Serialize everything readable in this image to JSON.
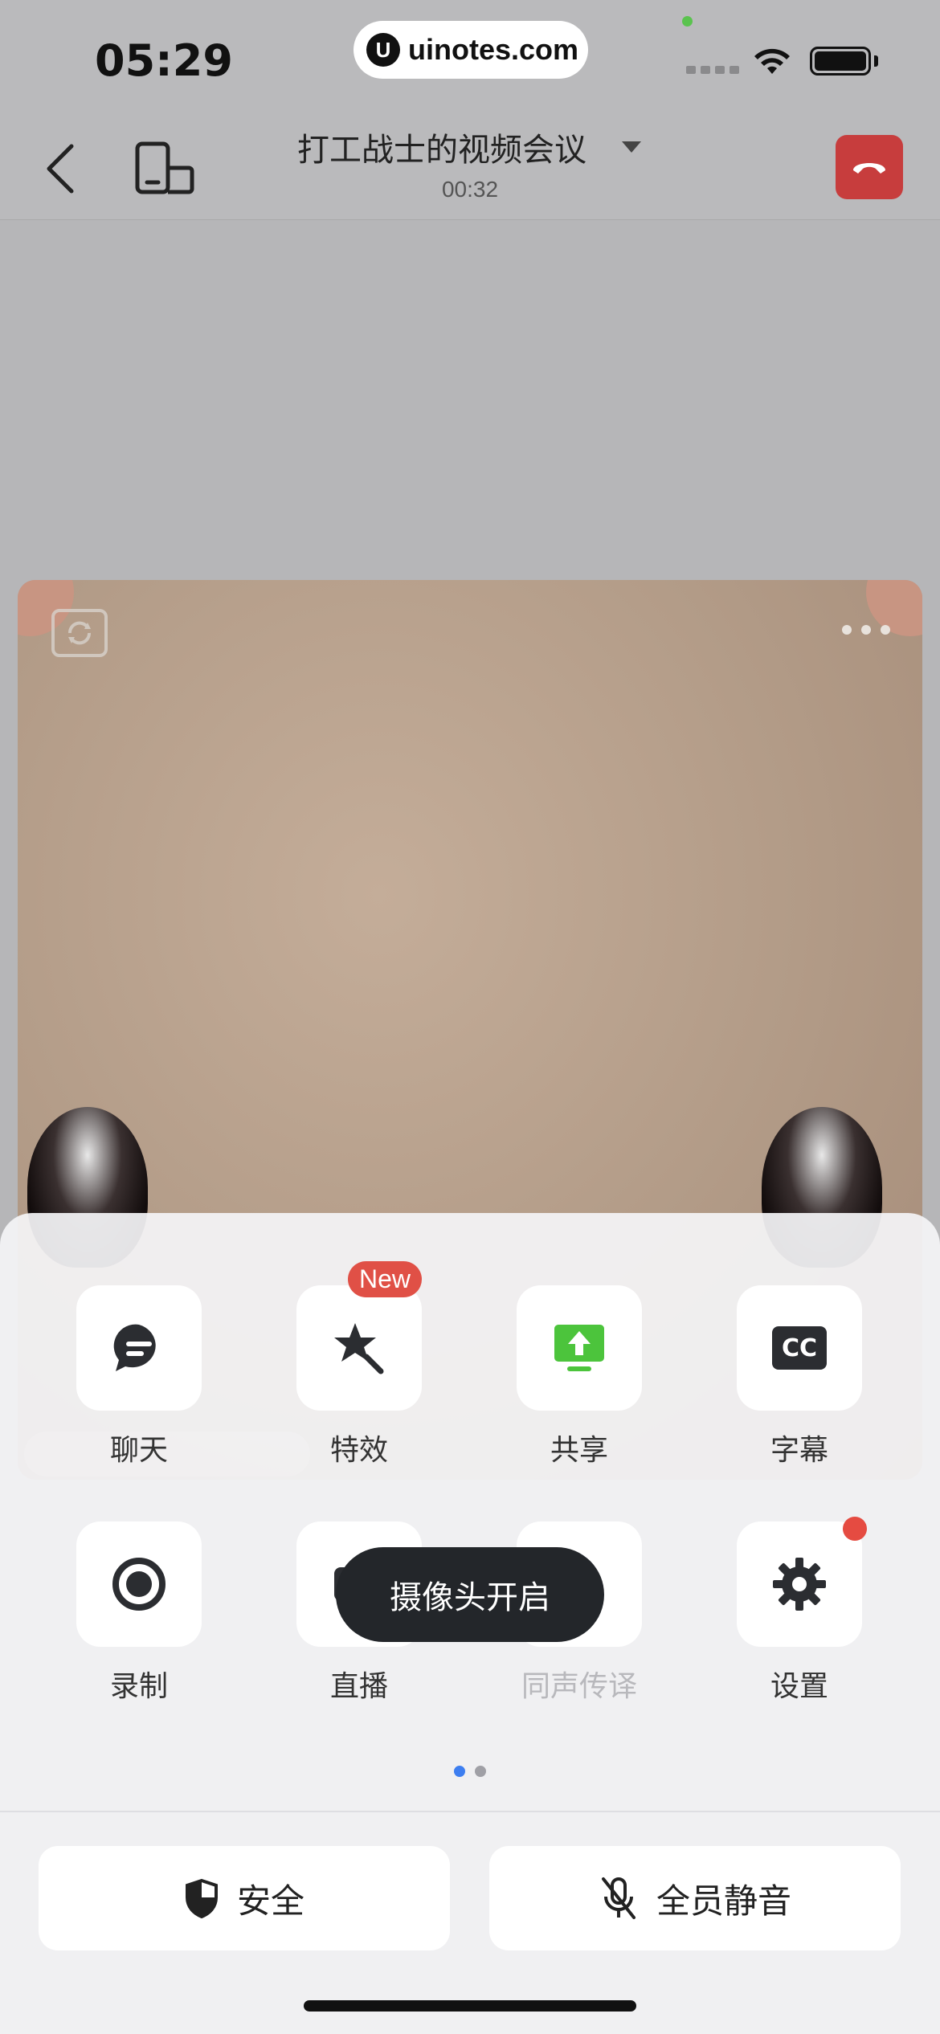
{
  "status_bar": {
    "time": "05:29",
    "url": "uinotes.com",
    "url_logo": "U"
  },
  "header": {
    "title": "打工战士的视频会议",
    "timer": "00:32"
  },
  "grid": [
    {
      "label": "聊天",
      "icon": "chat-icon",
      "disabled": false
    },
    {
      "label": "特效",
      "icon": "effects-icon",
      "badge": "New",
      "disabled": false
    },
    {
      "label": "共享",
      "icon": "share-screen-icon",
      "disabled": false
    },
    {
      "label": "字幕",
      "icon": "cc-icon",
      "icon_text": "CC",
      "disabled": false
    },
    {
      "label": "录制",
      "icon": "record-icon",
      "disabled": false
    },
    {
      "label": "直播",
      "icon": "live-icon",
      "disabled": false
    },
    {
      "label": "同声传译",
      "icon": "interpret-icon",
      "disabled": true
    },
    {
      "label": "设置",
      "icon": "gear-icon",
      "red_dot": true,
      "disabled": false
    }
  ],
  "toast": "摄像头开启",
  "pagination": {
    "pages": 2,
    "active": 1
  },
  "bottom_buttons": {
    "security": "安全",
    "mute_all": "全员静音"
  },
  "colors": {
    "accent": "#3d7ef0",
    "end_call": "#c73d3d",
    "share_green": "#4cc43c",
    "badge_red": "#e05046"
  }
}
